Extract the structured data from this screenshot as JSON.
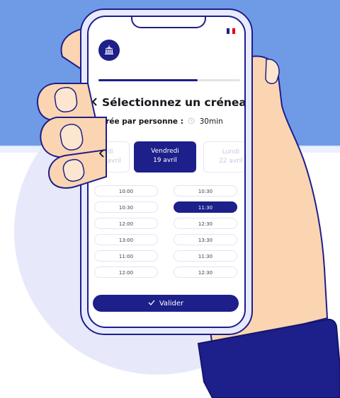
{
  "screen": {
    "title": "Sélectionnez un créneau",
    "duration_label": "Durée par personne :",
    "duration_value": "30min",
    "progress": 0.7,
    "days": {
      "prev": {
        "weekday": "di",
        "date": "18 avril"
      },
      "current": {
        "weekday": "Vendredi",
        "date": "19 avril"
      },
      "next": {
        "weekday": "Lundi",
        "date": "22 avril"
      }
    },
    "slots_left": [
      "10:00",
      "10:30",
      "12:00",
      "13:00",
      "11:00",
      "12:00"
    ],
    "slots_right": [
      "10:30",
      "11:30",
      "12:30",
      "13:30",
      "11:30",
      "12:30"
    ],
    "selected_slot": "11:30",
    "validate_label": "Valider"
  },
  "icons": {
    "back": "chevron-left-icon",
    "prev_day": "chevron-left-icon",
    "clock": "clock-icon",
    "logo": "town-hall-icon",
    "flag": "french-flag-icon",
    "check": "check-icon"
  },
  "colors": {
    "primary": "#1d1f8a",
    "background_band": "#6f9be6",
    "circle": "#e7e9fb",
    "skin": "#fbd5b1",
    "flag_blue": "#1d1f8a",
    "flag_red": "#e1000f"
  }
}
